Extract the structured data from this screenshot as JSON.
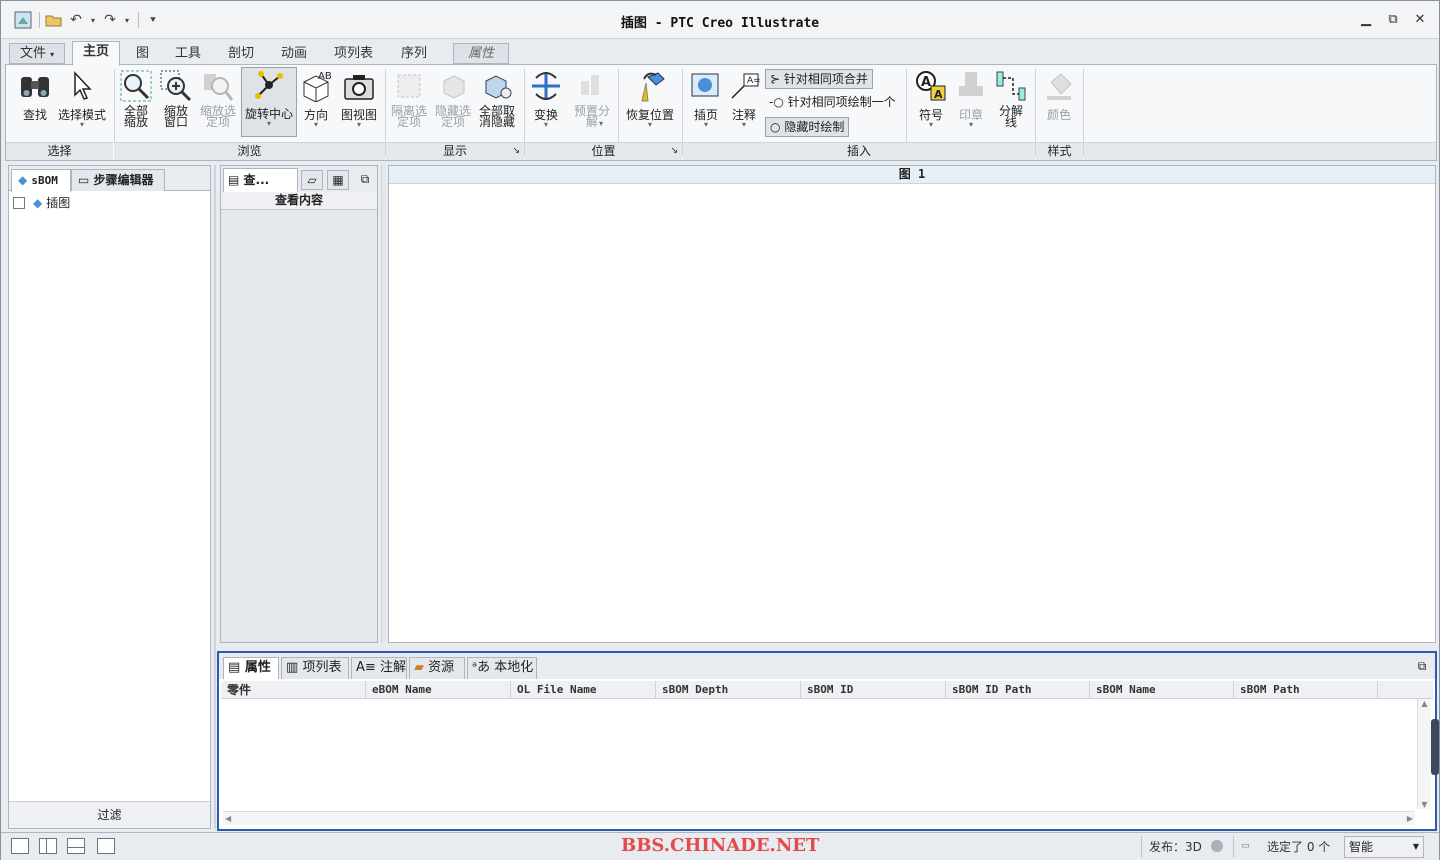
{
  "title": "插图 - PTC Creo Illustrate",
  "window": {
    "minimize": "▭",
    "restore": "⧉",
    "close": "✕"
  },
  "tabs": {
    "file": "文件",
    "home": "主页",
    "figure": "图",
    "tools": "工具",
    "section": "剖切",
    "animation": "动画",
    "bom": "项列表",
    "sequence": "序列",
    "properties": "属性"
  },
  "ribbon": {
    "find": "查找",
    "select_mode": "选择模式",
    "zoom_all": "全部\n缩放",
    "zoom_window": "缩放\n窗口",
    "zoom_selected": "缩放选\n定项",
    "spin_center": "旋转中心",
    "orientation": "方向",
    "view_mode": "图视图",
    "isolate": "隔离选\n定项",
    "hide": "隐藏选\n定项",
    "unhide_all": "全部取\n消隐藏",
    "transform": "变换",
    "preset_explode": "预置分\n解",
    "restore_position": "恢复位置",
    "callout_page": "插页",
    "annotation": "注释",
    "merge_same": "针对相同项合并",
    "draw_one": "针对相同项绘制一个",
    "draw_hidden": "隐藏时绘制",
    "symbol": "符号",
    "stamp": "印章",
    "explode_line": "分解\n线",
    "color": "颜色",
    "groups": {
      "select": "选择",
      "browse": "浏览",
      "display": "显示",
      "position": "位置",
      "insert": "插入",
      "style": "样式"
    }
  },
  "left_panel": {
    "tab_sbom": "sBOM",
    "tab_step_editor": "步骤编辑器",
    "tree_item": "插图",
    "filter": "过滤"
  },
  "mid_panel": {
    "tab_label": "查...",
    "header": "查看内容"
  },
  "canvas": {
    "header": "图 1"
  },
  "bottom_panel": {
    "tabs": [
      "属性",
      "项列表",
      "注解",
      "资源",
      "本地化"
    ],
    "columns": [
      "零件",
      "eBOM Name",
      "OL File Name",
      "sBOM Depth",
      "sBOM ID",
      "sBOM ID Path",
      "sBOM Name",
      "sBOM Path"
    ]
  },
  "status": {
    "publish": "发布：3D",
    "selected": "选定了 0 个",
    "mode": "智能"
  },
  "watermark": "BBS.CHINADE.NET"
}
